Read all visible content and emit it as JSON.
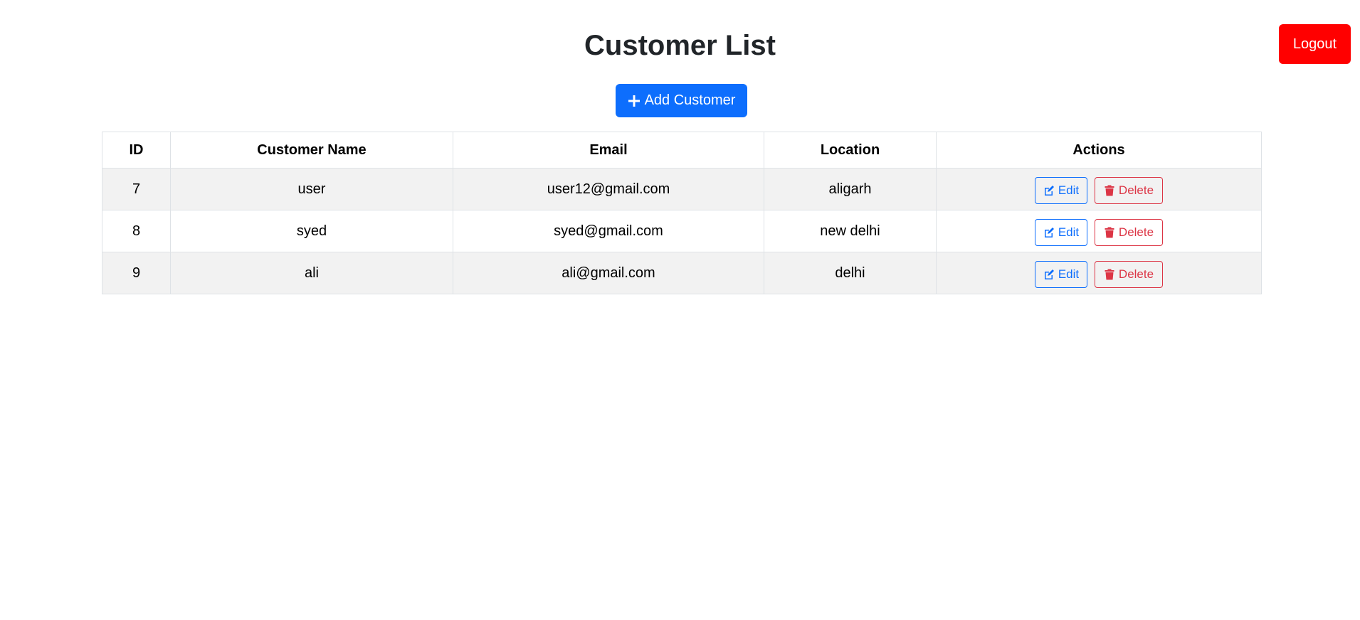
{
  "header": {
    "title": "Customer List",
    "logout_label": "Logout",
    "add_label": "Add Customer"
  },
  "table": {
    "columns": [
      "ID",
      "Customer Name",
      "Email",
      "Location",
      "Actions"
    ],
    "rows": [
      {
        "id": "7",
        "name": "user",
        "email": "user12@gmail.com",
        "location": "aligarh",
        "edit_label": "Edit",
        "delete_label": "Delete"
      },
      {
        "id": "8",
        "name": "syed",
        "email": "syed@gmail.com",
        "location": "new delhi",
        "edit_label": "Edit",
        "delete_label": "Delete"
      },
      {
        "id": "9",
        "name": "ali",
        "email": "ali@gmail.com",
        "location": "delhi",
        "edit_label": "Edit",
        "delete_label": "Delete"
      }
    ]
  },
  "colors": {
    "logout": "#ff0000",
    "primary": "#0d6efd",
    "danger": "#dc3545",
    "stripe": "#f2f2f2"
  },
  "icons": {
    "add": "plus-icon",
    "edit": "edit-icon",
    "delete": "trash-icon"
  }
}
